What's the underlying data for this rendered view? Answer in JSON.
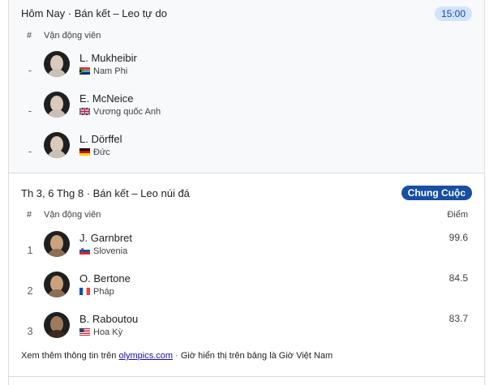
{
  "section_today": {
    "title": "Hôm Nay · Bán kết – Leo tự do",
    "badge": "15:00",
    "col_rank": "#",
    "col_athlete": "Vận động viên",
    "rows": [
      {
        "rank": "-",
        "name": "L. Mukheibir",
        "country": "Nam Phi",
        "flag_icon": "south-africa-flag-icon"
      },
      {
        "rank": "-",
        "name": "E. McNeice",
        "country": "Vương quốc Anh",
        "flag_icon": "uk-flag-icon"
      },
      {
        "rank": "-",
        "name": "L. Dörffel",
        "country": "Đức",
        "flag_icon": "germany-flag-icon"
      }
    ]
  },
  "section_past": {
    "title": "Th 3, 6 Thg 8 · Bán kết – Leo núi đá",
    "badge": "Chung Cuộc",
    "col_rank": "#",
    "col_athlete": "Vận động viên",
    "col_score": "Điểm",
    "rows": [
      {
        "rank": "1",
        "name": "J. Garnbret",
        "country": "Slovenia",
        "score": "99.6",
        "flag_icon": "slovenia-flag-icon"
      },
      {
        "rank": "2",
        "name": "O. Bertone",
        "country": "Pháp",
        "score": "84.5",
        "flag_icon": "france-flag-icon"
      },
      {
        "rank": "3",
        "name": "B. Raboutou",
        "country": "Hoa Kỳ",
        "score": "83.7",
        "flag_icon": "usa-flag-icon"
      }
    ]
  },
  "footer": {
    "prefix": "Xem thêm thông tin trên ",
    "link": "olympics.com",
    "separator": " · ",
    "note": "Giờ hiển thị trên bảng là Giờ Việt Nam"
  },
  "colors": {
    "time_badge_bg": "#d2e3fc",
    "final_badge_bg": "#174ea6",
    "link": "#1a0dab"
  }
}
